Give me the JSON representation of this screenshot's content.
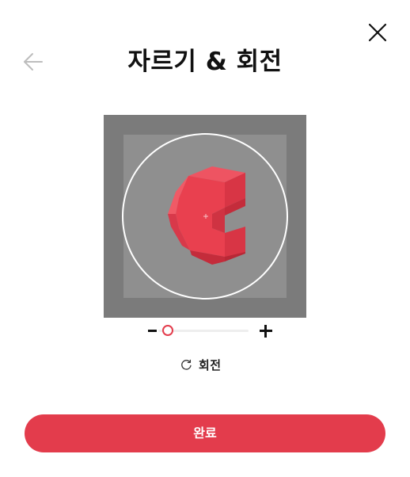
{
  "header": {
    "title": "자르기 & 회전",
    "back_icon": "arrow-left-icon",
    "close_icon": "close-icon"
  },
  "cropper": {
    "zoom_level": 0.05,
    "zoom_out_icon": "minus-icon",
    "zoom_in_icon": "plus-icon",
    "image_subject": "red-c-shaped-block"
  },
  "rotate": {
    "icon": "rotate-icon",
    "label": "회전"
  },
  "footer": {
    "done_label": "완료"
  },
  "colors": {
    "accent": "#e33c4c",
    "crop_backdrop": "#7b7b7b",
    "image_background": "#8f8f8f",
    "shape_front": "#e9404f",
    "shape_light": "#f05a66",
    "shape_dark": "#c42c3b"
  }
}
